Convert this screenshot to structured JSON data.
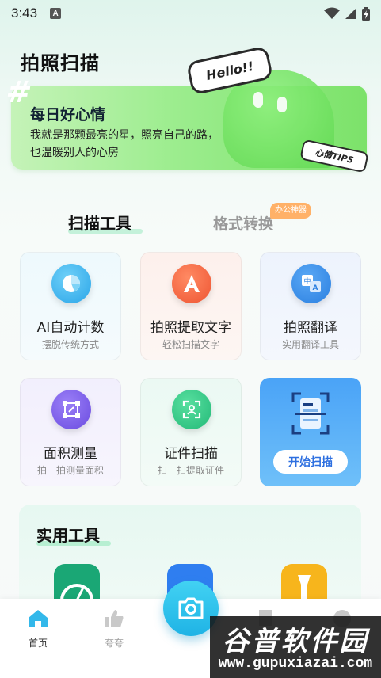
{
  "status": {
    "time": "3:43",
    "notif_letter": "A"
  },
  "app_title": "拍照扫描",
  "banner": {
    "hash": "#",
    "heading": "每日好心情",
    "text": "我就是那颗最亮的星，照亮自己的路，也温暖别人的心房",
    "hello": "Hello!!",
    "tips": "心情TIPS"
  },
  "tabs": [
    {
      "label": "扫描工具",
      "active": true
    },
    {
      "label": "格式转换",
      "active": false,
      "badge": "办公神器"
    }
  ],
  "tools": [
    {
      "title": "AI自动计数",
      "subtitle": "摆脱传统方式",
      "icon": "pie-chart-icon",
      "color": "#3fb2ec"
    },
    {
      "title": "拍照提取文字",
      "subtitle": "轻松扫描文字",
      "icon": "letter-a-icon",
      "color": "#f2603f"
    },
    {
      "title": "拍照翻译",
      "subtitle": "实用翻译工具",
      "icon": "translate-icon",
      "color": "#2f8be6"
    },
    {
      "title": "面积测量",
      "subtitle": "拍一拍测量面积",
      "icon": "measure-icon",
      "color": "#7a5ae8"
    },
    {
      "title": "证件扫描",
      "subtitle": "扫一扫提取证件",
      "icon": "id-scan-icon",
      "color": "#2fc58a"
    }
  ],
  "start_scan": {
    "label": "开始扫描",
    "icon": "document-scan-icon"
  },
  "utilities": {
    "title": "实用工具"
  },
  "nav": [
    {
      "label": "首页",
      "icon": "home-icon",
      "active": true
    },
    {
      "label": "夸夸",
      "icon": "thumbs-up-icon",
      "active": false
    }
  ],
  "fab_icon": "camera-icon",
  "watermark": {
    "title": "谷普软件园",
    "url": "www.gupuxiazai.com"
  }
}
